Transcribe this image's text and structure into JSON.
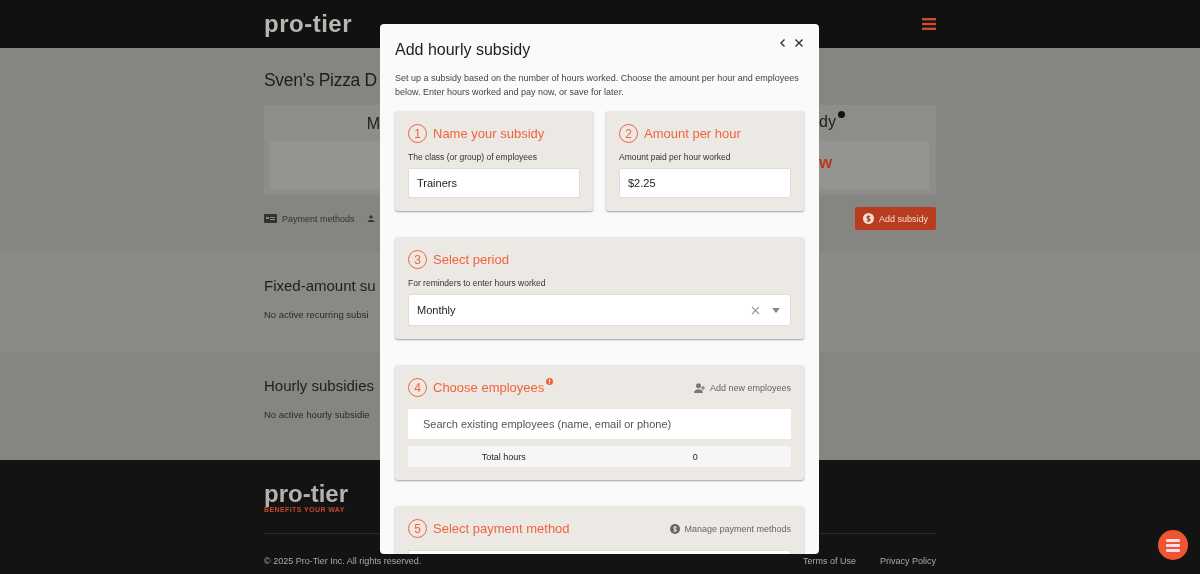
{
  "header": {
    "logo": "pro-tier"
  },
  "page": {
    "title": "Sven's Pizza D",
    "card": {
      "left_title": "M",
      "right_title": "dy",
      "right_value": "w"
    },
    "actions": [
      {
        "kind": "card",
        "label": "Payment methods"
      },
      {
        "kind": "person"
      }
    ],
    "add_button": "Add subsidy",
    "sections": [
      {
        "title": "Fixed-amount su",
        "empty_text": "No active recurring subsi"
      },
      {
        "title": "Hourly subsidies",
        "empty_text": "No active hourly subsidie"
      }
    ]
  },
  "footer": {
    "logo": "pro-tier",
    "tagline": "BENEFITS YOUR WAY",
    "copyright": "© 2025 Pro-Tier Inc. All rights reserved.",
    "links": [
      "Terms of Use",
      "Privacy Policy"
    ]
  },
  "modal": {
    "title": "Add hourly subsidy",
    "description": "Set up a subsidy based on the number of hours worked. Choose the amount per hour and employees below. Enter hours worked and pay now, or save for later.",
    "steps": [
      {
        "kind": "text",
        "number": "1",
        "title": "Name your subsidy",
        "label": "The class (or group) of employees",
        "value": "Trainers"
      },
      {
        "kind": "text",
        "number": "2",
        "title": "Amount per hour",
        "label": "Amount paid per hour worked",
        "value": "$2.25"
      },
      {
        "kind": "select",
        "number": "3",
        "title": "Select period",
        "label": "For reminders to enter hours worked",
        "value": "Monthly"
      },
      {
        "kind": "employees",
        "number": "4",
        "title": "Choose employees",
        "action": "Add new employees",
        "placeholder": "Search existing employees (name, email or phone)",
        "total_label": "Total hours",
        "total": "0"
      },
      {
        "kind": "payment",
        "number": "5",
        "title": "Select payment method",
        "action": "Manage payment methods"
      }
    ]
  }
}
